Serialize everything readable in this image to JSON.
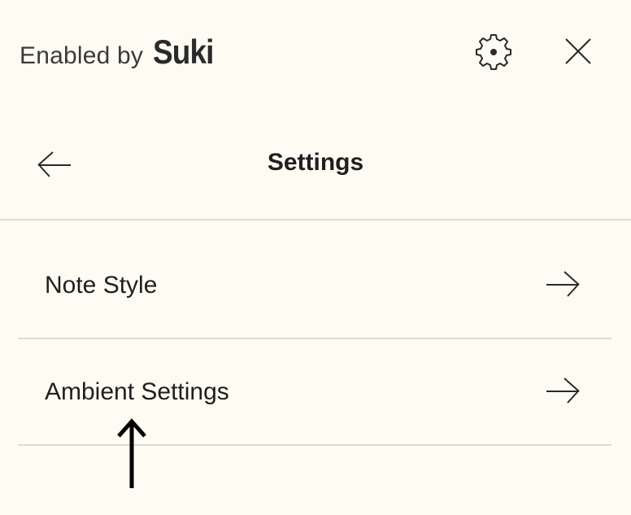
{
  "branding": {
    "prefix": "Enabled by",
    "logo": "Suki"
  },
  "topbar": {
    "settings_icon": "gear-icon",
    "close_icon": "close-icon"
  },
  "header": {
    "back_icon": "arrow-left-icon",
    "title": "Settings"
  },
  "settings_list": [
    {
      "label": "Note Style",
      "icon": "arrow-right-icon"
    },
    {
      "label": "Ambient Settings",
      "icon": "arrow-right-icon"
    }
  ],
  "annotation": {
    "icon": "arrow-up-icon",
    "color": "#000000"
  },
  "colors": {
    "background": "#fdfbf2",
    "text": "#1f1f1f",
    "divider": "#dcdad2"
  }
}
